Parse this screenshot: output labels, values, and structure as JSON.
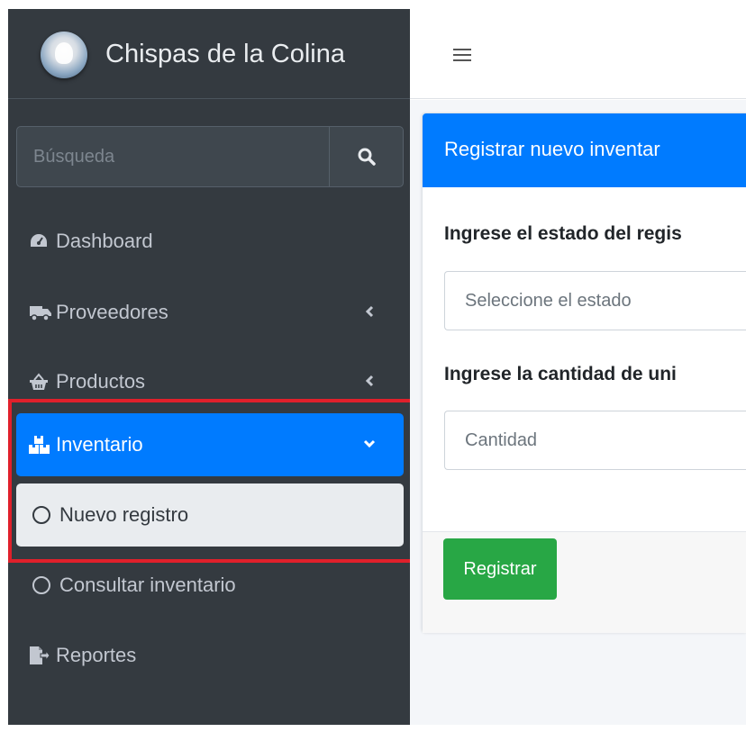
{
  "brand": {
    "name": "Chispas de la Colina",
    "logo_icon": "brand-avatar-icon"
  },
  "search": {
    "placeholder": "Búsqueda",
    "button_icon": "search-icon"
  },
  "sidebar": {
    "items": [
      {
        "label": "Dashboard",
        "icon": "tachometer-icon"
      },
      {
        "label": "Proveedores",
        "icon": "truck-icon",
        "chevron": "chevron-left-icon"
      },
      {
        "label": "Productos",
        "icon": "basket-icon",
        "chevron": "chevron-left-icon"
      },
      {
        "label": "Inventario",
        "icon": "boxes-icon",
        "chevron": "chevron-down-icon",
        "active": true
      },
      {
        "label": "Nuevo registro",
        "icon": "circle-icon",
        "active": true
      },
      {
        "label": "Consultar inventario",
        "icon": "circle-icon"
      },
      {
        "label": "Reportes",
        "icon": "file-export-icon"
      }
    ]
  },
  "topbar": {
    "menu_icon": "hamburger-icon"
  },
  "form": {
    "title": "Registrar nuevo inventar",
    "state_label": "Ingrese el estado del regis",
    "state_placeholder": "Seleccione el estado",
    "quantity_label": "Ingrese la cantidad de uni",
    "quantity_placeholder": "Cantidad",
    "submit_label": "Registrar"
  },
  "colors": {
    "sidebar_bg": "#343a40",
    "primary": "#007bff",
    "success": "#28a745",
    "highlight": "#e0202b"
  }
}
